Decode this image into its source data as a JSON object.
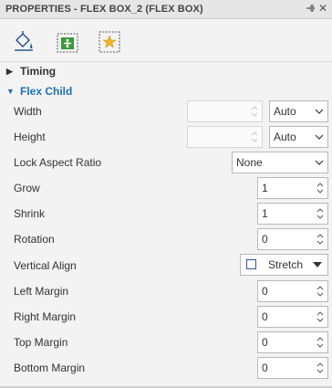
{
  "panel": {
    "title": "PROPERTIES - FLEX BOX_2 (FLEX BOX)",
    "close_glyph": "✕"
  },
  "tabs": [
    {
      "name": "fill-bucket-icon"
    },
    {
      "name": "position-size-icon"
    },
    {
      "name": "effects-star-icon"
    }
  ],
  "sections": {
    "timing": {
      "label": "Timing",
      "expanded": false
    },
    "flex_child": {
      "label": "Flex Child",
      "expanded": true
    }
  },
  "fields": {
    "width": {
      "label": "Width",
      "value": "",
      "unit": "Auto"
    },
    "height": {
      "label": "Height",
      "value": "",
      "unit": "Auto"
    },
    "lock_aspect": {
      "label": "Lock Aspect Ratio",
      "value": "None"
    },
    "grow": {
      "label": "Grow",
      "value": "1"
    },
    "shrink": {
      "label": "Shrink",
      "value": "1"
    },
    "rotation": {
      "label": "Rotation",
      "value": "0"
    },
    "vertical_align": {
      "label": "Vertical Align",
      "value": "Stretch"
    },
    "left_margin": {
      "label": "Left Margin",
      "value": "0"
    },
    "right_margin": {
      "label": "Right Margin",
      "value": "0"
    },
    "top_margin": {
      "label": "Top Margin",
      "value": "0"
    },
    "bottom_margin": {
      "label": "Bottom Margin",
      "value": "0"
    }
  },
  "colors": {
    "accent": "#2b579a",
    "section_blue": "#1f6fb5"
  }
}
